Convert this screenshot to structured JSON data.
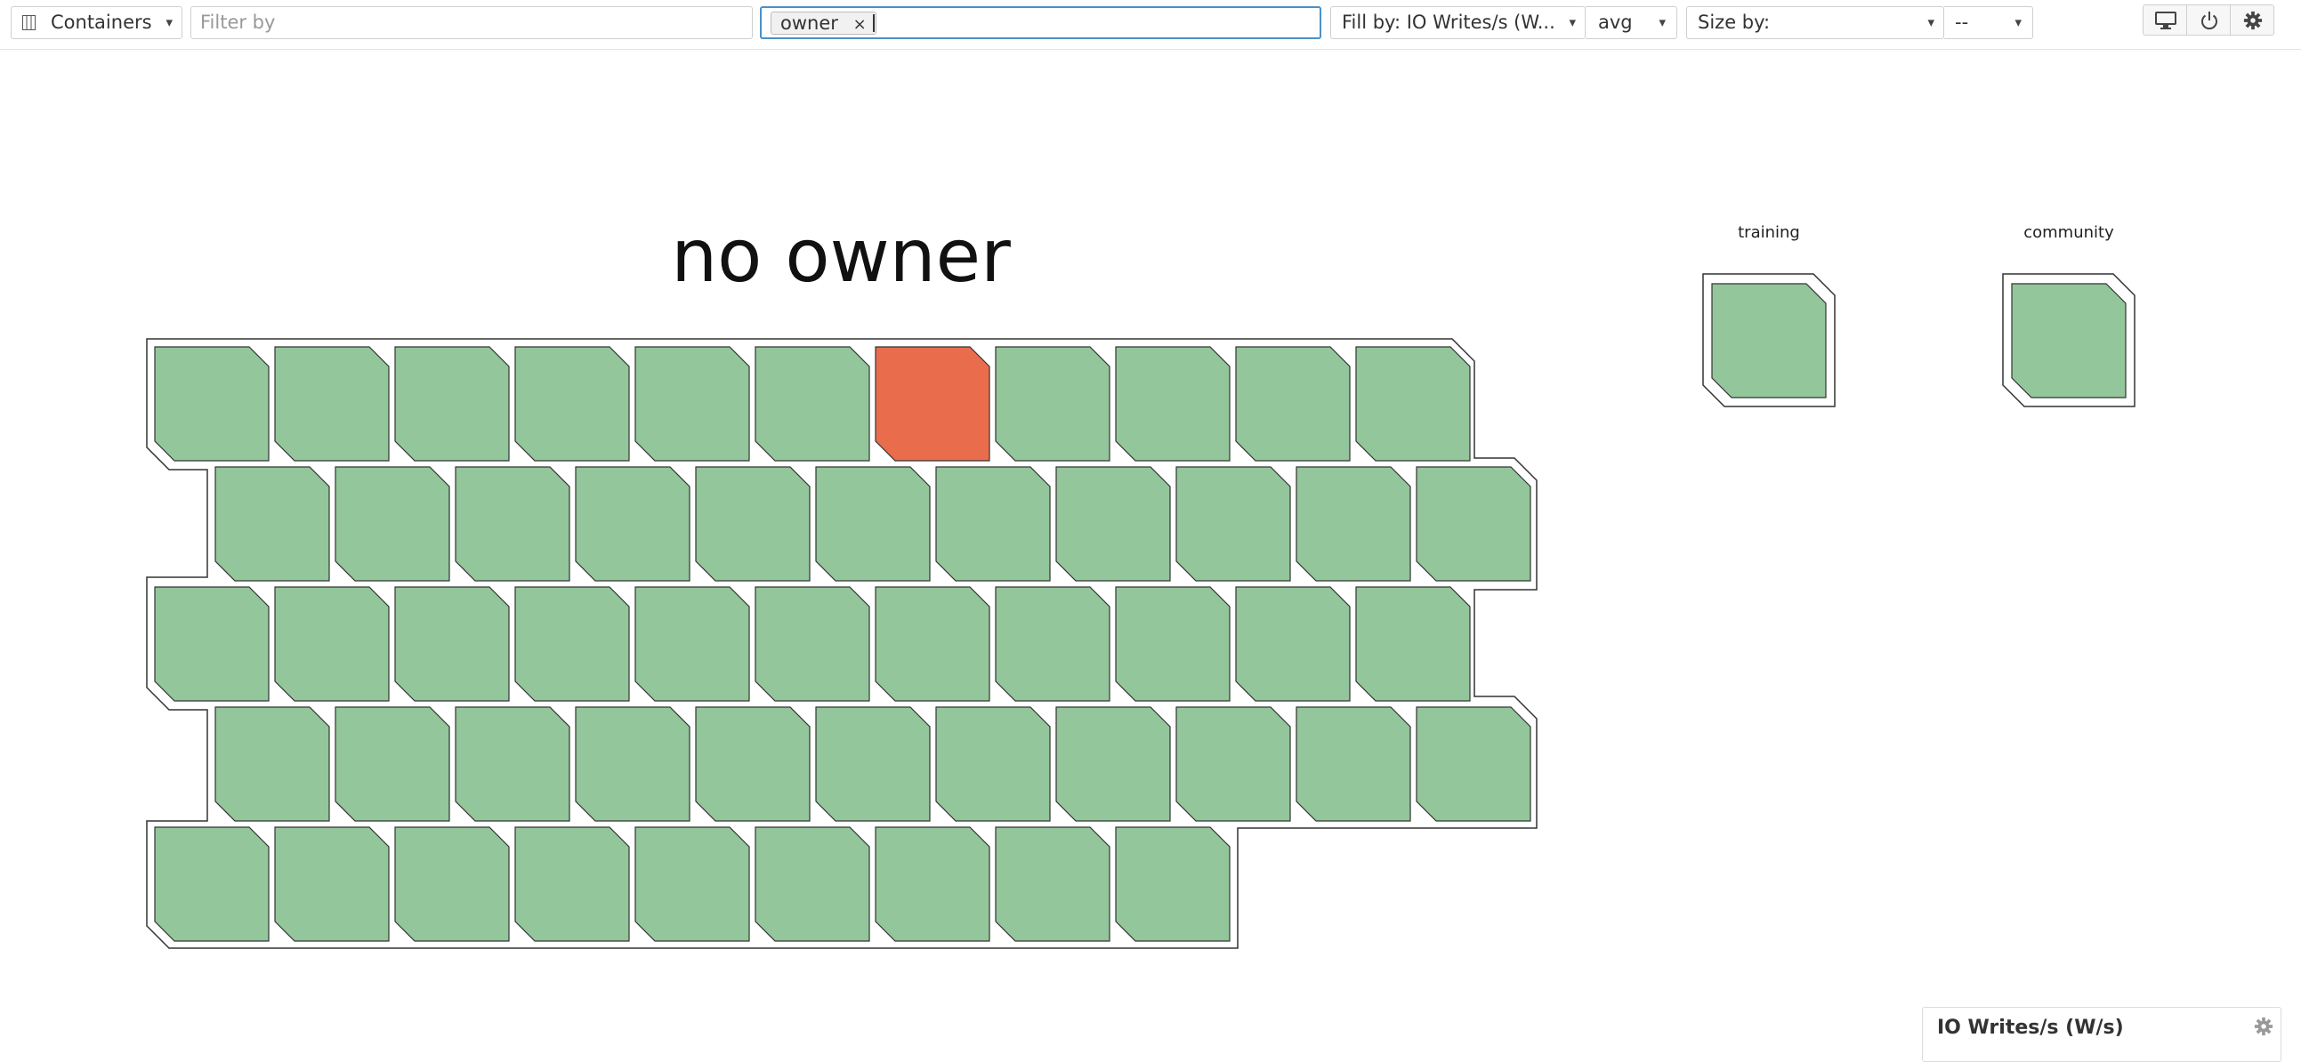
{
  "toolbar": {
    "view_select": "Containers",
    "filter_placeholder": "Filter by",
    "group_tag": "owner",
    "group_tag_remove": "×",
    "fill_by": "Fill by: IO Writes/s (W...",
    "fill_agg": "avg",
    "size_by": "Size by:",
    "size_agg": "--",
    "caret": "▾"
  },
  "groups": [
    {
      "name": "no owner",
      "tiles": 53,
      "rows": [
        11,
        11,
        11,
        11,
        9
      ],
      "alert_index": 6
    },
    {
      "name": "training",
      "tiles": 1
    },
    {
      "name": "community",
      "tiles": 1
    }
  ],
  "colors": {
    "ok": "#93c69b",
    "alert": "#e96d4d",
    "border": "#333333",
    "accent": "#4a90c9"
  },
  "legend": {
    "title": "IO Writes/s (W/s)"
  }
}
